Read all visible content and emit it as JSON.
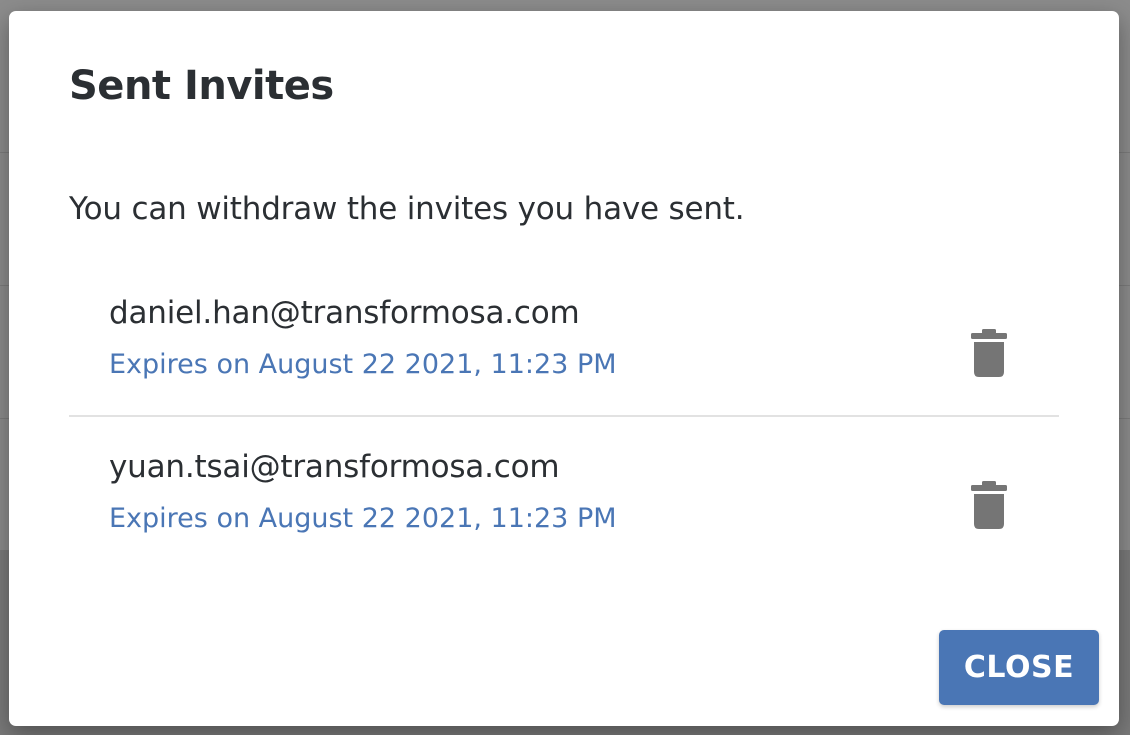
{
  "dialog": {
    "title": "Sent Invites",
    "description": "You can withdraw the invites you have sent.",
    "close_label": "CLOSE"
  },
  "invites": [
    {
      "email": "daniel.han@transformosa.com",
      "expiry": "Expires on August 22 2021, 11:23 PM",
      "delete_icon": "trash-icon"
    },
    {
      "email": "yuan.tsai@transformosa.com",
      "expiry": "Expires on August 22 2021, 11:23 PM",
      "delete_icon": "trash-icon"
    }
  ],
  "colors": {
    "accent": "#4a76b5",
    "icon": "#757575",
    "text": "#2b2f33",
    "overlay": "#8c8c8c"
  }
}
